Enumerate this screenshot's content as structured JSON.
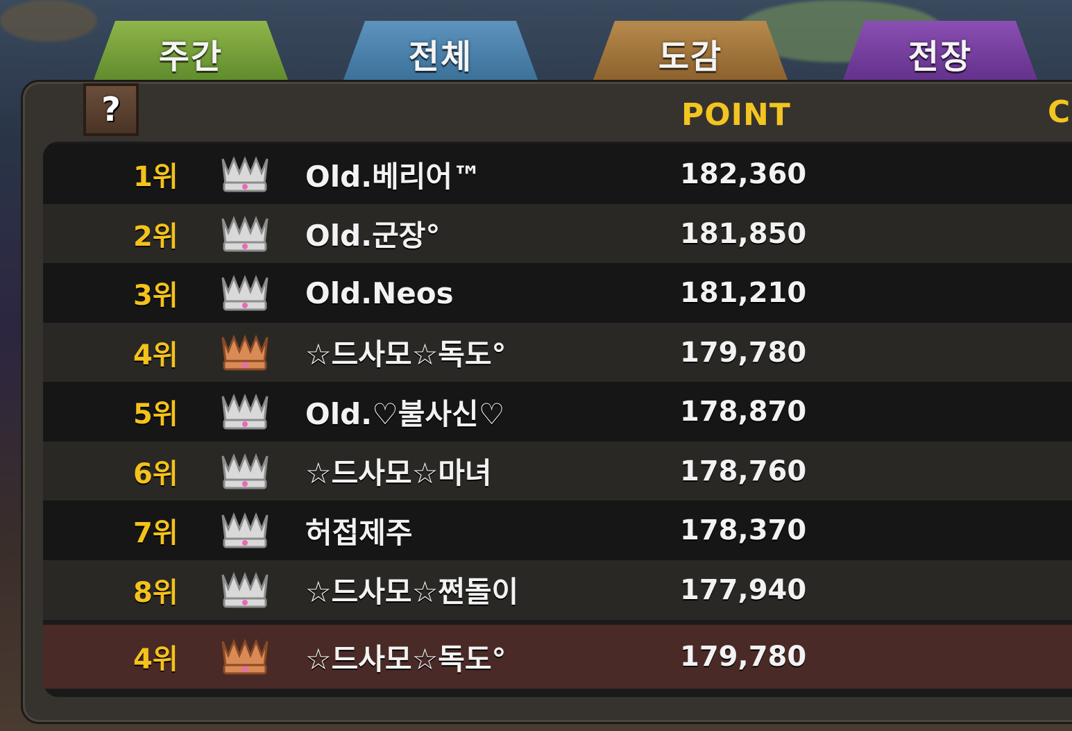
{
  "tabs": [
    {
      "label": "주간"
    },
    {
      "label": "전체"
    },
    {
      "label": "도감"
    },
    {
      "label": "전장"
    }
  ],
  "help": {
    "label": "?"
  },
  "header": {
    "point_label": "POINT",
    "cut_label": "C"
  },
  "rows": [
    {
      "rank": "1위",
      "crown": "silver-crown-icon",
      "name": "Old.베리어™",
      "points": "182,360"
    },
    {
      "rank": "2위",
      "crown": "silver-crown-icon",
      "name": "Old.군장°",
      "points": "181,850"
    },
    {
      "rank": "3위",
      "crown": "silver-crown-icon",
      "name": "Old.Neos",
      "points": "181,210"
    },
    {
      "rank": "4위",
      "crown": "bronze-crown-icon",
      "name": "☆드사모☆독도°",
      "points": "179,780"
    },
    {
      "rank": "5위",
      "crown": "silver-crown-icon",
      "name": "Old.♡불사신♡",
      "points": "178,870"
    },
    {
      "rank": "6위",
      "crown": "silver-crown-icon",
      "name": "☆드사모☆마녀",
      "points": "178,760"
    },
    {
      "rank": "7위",
      "crown": "silver-crown-icon",
      "name": "허접제주",
      "points": "178,370"
    },
    {
      "rank": "8위",
      "crown": "silver-crown-icon",
      "name": "☆드사모☆쩐돌이",
      "points": "177,940"
    }
  ],
  "my_rank": {
    "rank": "4위",
    "crown": "bronze-crown-icon",
    "name": "☆드사모☆독도°",
    "points": "179,780"
  },
  "colors": {
    "rank_gold": "#f4c21c",
    "header_gold": "#f2c520",
    "silver_crown": "#d9d9d9",
    "bronze_crown": "#d98a55",
    "my_row_bg": "#4a2a26"
  }
}
